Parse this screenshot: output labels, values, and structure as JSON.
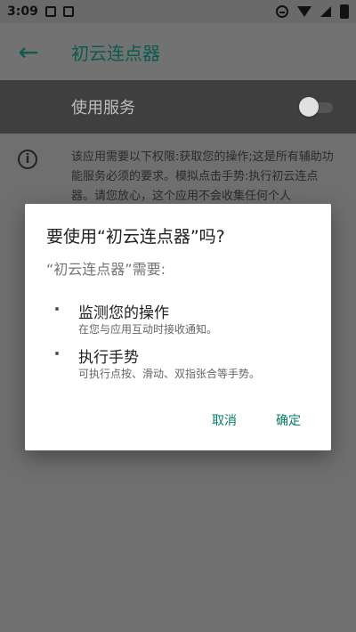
{
  "status_bar": {
    "time": "3:09",
    "left_icons": [
      "image-icon",
      "a-icon"
    ],
    "right_icons": [
      "do-not-disturb-icon",
      "wifi-icon",
      "signal-icon",
      "battery-icon"
    ]
  },
  "appbar": {
    "back_icon": "arrow-left-icon",
    "title": "初云连点器"
  },
  "service": {
    "label": "使用服务",
    "toggle_state": "off"
  },
  "info": {
    "icon": "info-icon",
    "text": "该应用需要以下权限:获取您的操作;这是所有辅助功能服务必须的要求。模拟点击手势:执行初云连点器。请您放心，这个应用不会收集任何个人"
  },
  "dialog": {
    "title": "要使用“初云连点器”吗?",
    "subtitle": "“初云连点器”需要:",
    "items": [
      {
        "title": "监测您的操作",
        "desc": "在您与应用互动时接收通知。"
      },
      {
        "title": "执行手势",
        "desc": "可执行点按、滑动、双指张合等手势。"
      }
    ],
    "cancel_label": "取消",
    "ok_label": "确定"
  },
  "colors": {
    "accent": "#0a7a6a",
    "overlay": "#6f6f6f",
    "service_bar": "#3f3f3f"
  }
}
